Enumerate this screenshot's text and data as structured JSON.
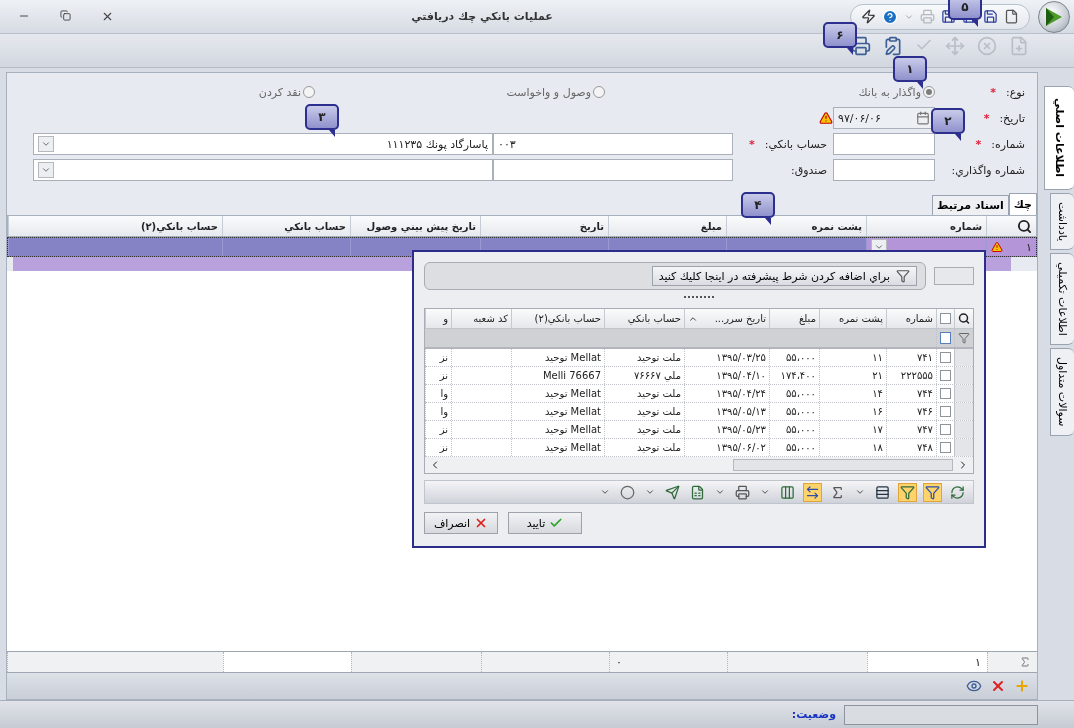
{
  "window": {
    "title": "عمليات بانكي چك دريافتي"
  },
  "callouts": [
    "۱",
    "۲",
    "۳",
    "۴",
    "۵",
    "۶"
  ],
  "form": {
    "type": {
      "label": "نوع:",
      "required_mark": "*",
      "options": [
        {
          "label": "واگذار به بانك",
          "selected": true
        },
        {
          "label": "وصول و واخواست",
          "selected": false
        },
        {
          "label": "نقد كردن",
          "selected": false
        }
      ]
    },
    "date": {
      "label": "تاريخ:",
      "required_mark": "*",
      "value": "۹۷/۰۶/۰۶"
    },
    "number": {
      "label": "شماره:",
      "required_mark": "*"
    },
    "bank_account": {
      "label": "حساب بانكي:",
      "required_mark": "*",
      "code": "۰۰۳",
      "name": "پاسارگاد پونك ۱۱۱۲۳۵"
    },
    "deposit_number": {
      "label": "شماره واگذاري:"
    },
    "fund": {
      "label": "صندوق:"
    }
  },
  "detail_tabs": [
    {
      "label": "چك",
      "selected": true
    },
    {
      "label": "اسناد مرتبط",
      "selected": false
    }
  ],
  "grid": {
    "columns": [
      "شماره",
      "پشت نمره",
      "مبلغ",
      "تاريخ",
      "تاريخ پيش بيني وصول",
      "حساب بانكي",
      "حساب بانكي(۲)"
    ],
    "rows": [
      {
        "row_number": "۱"
      }
    ],
    "footer": {
      "count": "۱",
      "amount": "۰"
    }
  },
  "side_tabs": [
    {
      "label": "اطلاعات اصلي",
      "selected": true
    },
    {
      "label": "يادداشت",
      "selected": false
    },
    {
      "label": "اطلاعات تكميلي",
      "selected": false
    },
    {
      "label": "سوالات متداول",
      "selected": false
    }
  ],
  "lookup": {
    "all_checked": false,
    "filter_hint": "براي اضافه كردن شرط پيشرفته در اينجا كليك كنيد",
    "columns": [
      {
        "label": "شماره",
        "sorted": false
      },
      {
        "label": "پشت نمره",
        "sorted": false
      },
      {
        "label": "مبلغ",
        "sorted": false
      },
      {
        "label": "تاريخ سرر...",
        "sorted": true
      },
      {
        "label": "حساب بانكي",
        "sorted": false
      },
      {
        "label": "حساب بانكي(۲)",
        "sorted": false
      },
      {
        "label": "كد شعبه",
        "sorted": false
      },
      {
        "label": "و",
        "sorted": false
      }
    ],
    "rows": [
      {
        "checked": false,
        "cells": [
          "۷۴۱",
          "۱۱",
          "۵۵،۰۰۰",
          "۱۳۹۵/۰۳/۲۵",
          "ملت  توحيد",
          "Mellat  توحيد",
          "",
          "نز"
        ]
      },
      {
        "checked": false,
        "cells": [
          "۲۲۲۵۵۵",
          "۲۱",
          "۱۷۴،۴۰۰",
          "۱۳۹۵/۰۴/۱۰",
          "ملي  ۷۶۶۶۷",
          "Melli  76667",
          "",
          "نز"
        ]
      },
      {
        "checked": false,
        "cells": [
          "۷۴۴",
          "۱۴",
          "۵۵،۰۰۰",
          "۱۳۹۵/۰۴/۲۴",
          "ملت  توحيد",
          "Mellat  توحيد",
          "",
          "وا"
        ]
      },
      {
        "checked": false,
        "cells": [
          "۷۴۶",
          "۱۶",
          "۵۵،۰۰۰",
          "۱۳۹۵/۰۵/۱۳",
          "ملت  توحيد",
          "Mellat  توحيد",
          "",
          "وا"
        ]
      },
      {
        "checked": false,
        "cells": [
          "۷۴۷",
          "۱۷",
          "۵۵،۰۰۰",
          "۱۳۹۵/۰۵/۲۳",
          "ملت  توحيد",
          "Mellat  توحيد",
          "",
          "نز"
        ]
      },
      {
        "checked": false,
        "cells": [
          "۷۴۸",
          "۱۸",
          "۵۵،۰۰۰",
          "۱۳۹۵/۰۶/۰۲",
          "ملت  توحيد",
          "Mellat  توحيد",
          "",
          "نز"
        ]
      }
    ],
    "toolbar": [
      {
        "kind": "refresh",
        "on": false
      },
      {
        "kind": "filter",
        "on": true
      },
      {
        "kind": "filter-add",
        "on": true
      },
      {
        "kind": "list",
        "on": false
      },
      {
        "kind": "caret",
        "on": false
      },
      {
        "kind": "sigma",
        "on": false
      },
      {
        "kind": "swap",
        "on": true
      },
      {
        "kind": "columns",
        "on": false
      },
      {
        "kind": "caret",
        "on": false
      },
      {
        "kind": "print",
        "on": false
      },
      {
        "kind": "caret",
        "on": false
      },
      {
        "kind": "excel",
        "on": false
      },
      {
        "kind": "export",
        "on": false
      },
      {
        "kind": "caret",
        "on": false
      },
      {
        "kind": "circle",
        "on": false
      },
      {
        "kind": "caret",
        "on": false
      }
    ],
    "buttons": [
      {
        "kind": "ok",
        "label": "تاييد"
      },
      {
        "kind": "cancel",
        "label": "انصراف"
      }
    ]
  },
  "status_bar": {
    "label": "وضعيت:"
  }
}
